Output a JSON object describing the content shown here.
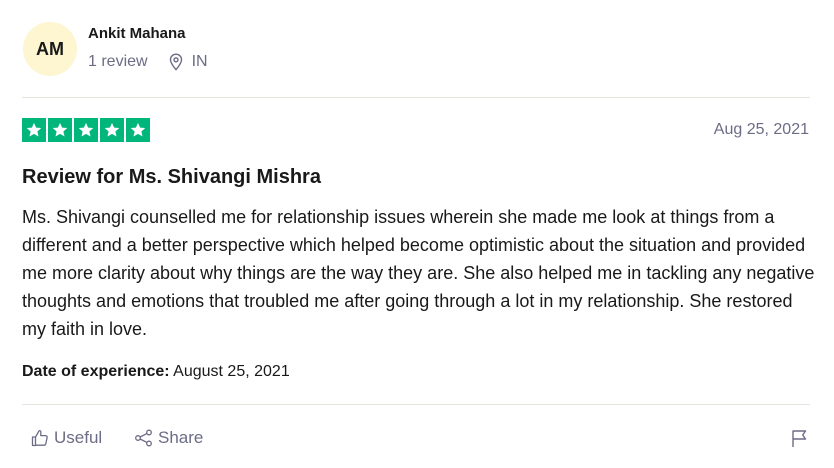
{
  "reviewer": {
    "initials": "AM",
    "name": "Ankit Mahana",
    "reviews": "1 review",
    "location": "IN"
  },
  "review": {
    "rating": 5,
    "rating_max": 5,
    "date": "Aug 25, 2021",
    "title": "Review for Ms. Shivangi Mishra",
    "body": "Ms. Shivangi counselled me for relationship issues wherein she made me look at things from a different and a better perspective which helped become optimistic about the situation and provided me more clarity about why things are the way they are. She also helped me in tackling any negative thoughts and emotions that troubled me after going through a lot in my relationship. She restored my faith in love.",
    "experience_label": "Date of experience:",
    "experience_date": "August 25, 2021"
  },
  "actions": {
    "useful": "Useful",
    "share": "Share"
  },
  "colors": {
    "star_green": "#00b67a",
    "avatar_bg": "#fdf6d1",
    "muted_text": "#6c6c85"
  },
  "icons": [
    "location-pin-icon",
    "star-icon",
    "thumbs-up-icon",
    "share-icon",
    "flag-icon"
  ]
}
